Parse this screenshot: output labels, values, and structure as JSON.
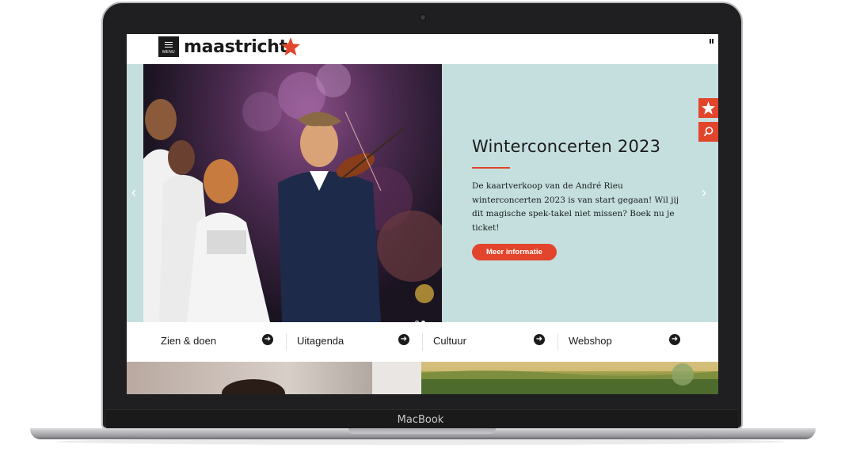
{
  "device": {
    "brand_label": "MacBook"
  },
  "header": {
    "menu_label": "MENU",
    "logo_text": "maastricht",
    "logo_star_color": "#e2452b"
  },
  "hero": {
    "title": "Winterconcerten 2023",
    "body": "De kaartverkoop van de André Rieu winterconcerten 2023 is van start gegaan! Wil jij dit magische spek-takel niet missen? Boek nu je ticket!",
    "cta_label": "Meer informatie",
    "background_color": "#c5dfdf",
    "accent_color": "#e2452b",
    "prev_icon": "chevron-left-icon",
    "next_icon": "chevron-right-icon",
    "pause_icon": "pause-icon",
    "slide_count": 2,
    "active_slide": 2
  },
  "side_buttons": [
    {
      "icon": "star-icon"
    },
    {
      "icon": "search-icon"
    }
  ],
  "quick_nav": [
    {
      "label": "Zien & doen"
    },
    {
      "label": "Uitagenda"
    },
    {
      "label": "Cultuur"
    },
    {
      "label": "Webshop"
    }
  ]
}
